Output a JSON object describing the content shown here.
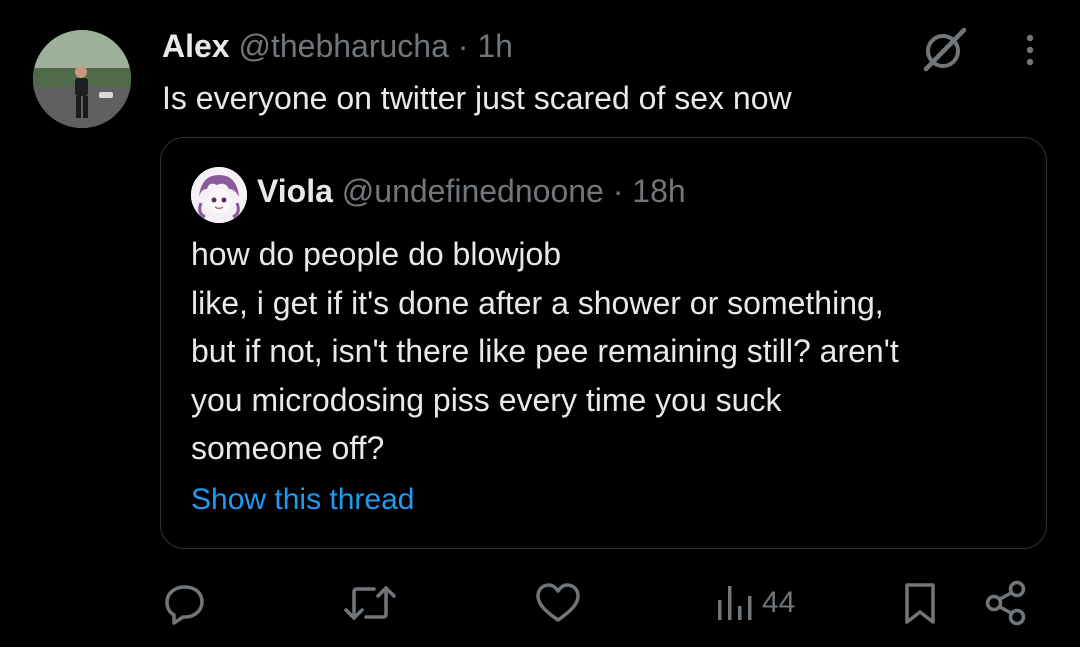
{
  "tweet": {
    "author_name": "Alex",
    "author_handle": "@thebharucha",
    "separator": "·",
    "time": "1h",
    "text": "Is everyone on twitter just scared of sex now"
  },
  "quote": {
    "author_name": "Viola",
    "author_handle": "@undefinednoone",
    "separator": "·",
    "time": "18h",
    "lines": [
      "how do people do blowjob",
      "like, i get if it's done after a shower or something,",
      "but if not, isn't there like pee remaining still? aren't",
      "you microdosing piss every time you suck",
      "someone off?"
    ],
    "show_thread": "Show this thread"
  },
  "actions": {
    "views": "44"
  },
  "icons": {
    "grok": "grok-icon",
    "more": "more-vertical-icon",
    "reply": "reply-icon",
    "retweet": "retweet-icon",
    "like": "heart-icon",
    "views": "views-chart-icon",
    "bookmark": "bookmark-icon",
    "share": "share-icon"
  },
  "colors": {
    "background": "#000000",
    "text": "#e7e9ea",
    "muted": "#71767b",
    "link": "#1d9bf0",
    "border": "#2f3336"
  }
}
